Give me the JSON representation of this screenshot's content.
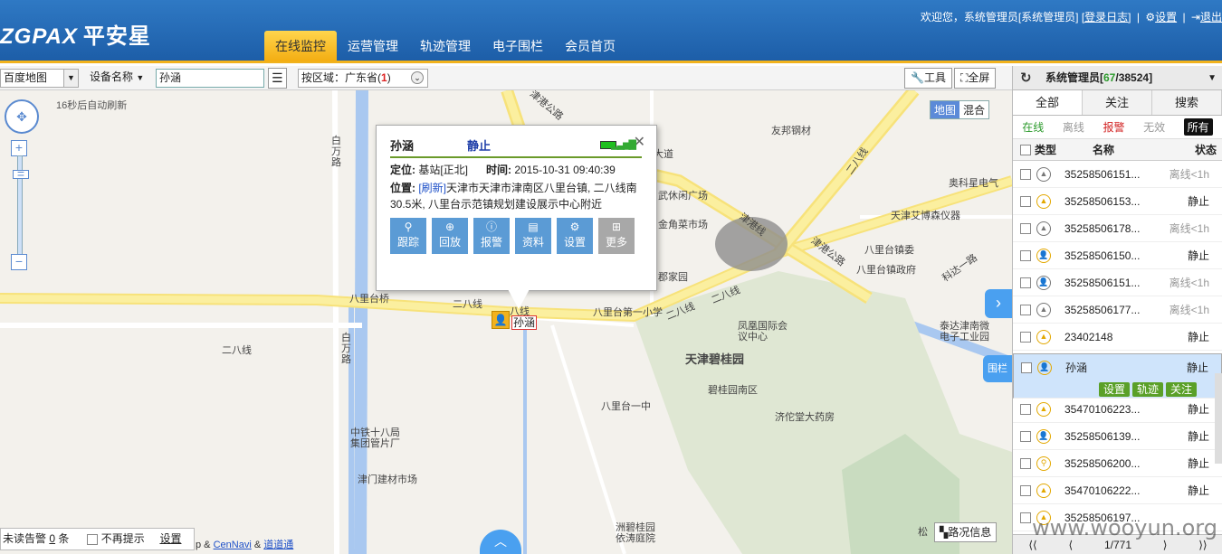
{
  "header": {
    "logo_en": "ZGPAX",
    "logo_cn": "平安星",
    "welcome": "欢迎您，系统管理员[系统管理员]",
    "login_log": "[登录日志]",
    "settings": "设置",
    "logout": "退出",
    "tabs": [
      {
        "label": "在线监控",
        "active": true
      },
      {
        "label": "运营管理"
      },
      {
        "label": "轨迹管理"
      },
      {
        "label": "电子围栏"
      },
      {
        "label": "会员首页"
      }
    ]
  },
  "toolbar": {
    "map_select": "百度地图",
    "search_field": "设备名称",
    "search_value": "孙涵",
    "region_label": "按区域：",
    "region_value": "广东省(",
    "region_count": "1",
    "region_close": ")",
    "tools_btn": "工具",
    "fullscreen_btn": "全屏"
  },
  "map": {
    "refresh": "16秒后自动刷新",
    "map_type_map": "地图",
    "map_type_mixed": "混合",
    "fence_btn": "围栏",
    "road_info": "路况信息",
    "copyright_prefix": "p &",
    "cennavi": "CenNavi",
    "amp": "&",
    "daodaotong": "道道通",
    "marker_label": "孙涵",
    "labels": {
      "bamian": "白万路",
      "jingang_top": "津港公路",
      "youbang": "友邦钢材",
      "dadao": "大道",
      "erbaxian_r": "二八线",
      "aokexing": "奥科星电气",
      "tianjinaitebo": "天津艾博森仪器",
      "jinjiao": "金角菜市场",
      "wuxiu": "武休闲广场",
      "jingang_mid": "津港线",
      "jingang_right": "津港公路",
      "baliwei": "八里台镇委",
      "balizf": "八里台镇政府",
      "kedaer": "科达一路",
      "jiajia": "郡家园",
      "baliqiao": "八里台桥",
      "erbaxian": "二八线",
      "baxian": "八线",
      "baliyi": "八里台第一小学",
      "erbaxian_m": "二八线",
      "erbaxian_m2": "二八线",
      "fenghuang": "凤凰国际会议中心",
      "taida": "泰达津南微电子工业园",
      "erbaxian_left": "二八线",
      "baiwan2": "白万路",
      "bigui": "天津碧桂园",
      "biguinan": "碧桂园南区",
      "balizhong": "八里台一中",
      "jituo": "济佗堂大药房",
      "zhongtie": "中铁十八局集团管片厂",
      "jinmen": "津门建材市场",
      "zhouqi": "洲碧桂园依涛庭院",
      "song": "松"
    },
    "alert": {
      "prefix": "未读告警",
      "count": "0",
      "suffix": "条",
      "no_remind": "不再提示",
      "settings": "设置"
    }
  },
  "popup": {
    "name": "孙涵",
    "status": "静止",
    "locate_label": "定位:",
    "locate_value": "基站[正北]",
    "time_label": "时间:",
    "time_value": "2015-10-31 09:40:39",
    "pos_label": "位置:",
    "refresh": "[刷新]",
    "address": "天津市天津市津南区八里台镇, 二八线南30.5米, 八里台示范镇规划建设展示中心附近",
    "actions": [
      "跟踪",
      "回放",
      "报警",
      "资料",
      "设置",
      "更多"
    ]
  },
  "sidebar": {
    "title": "系统管理员[",
    "online": "67",
    "slash": "/",
    "total": "38524",
    "close": "]",
    "tabs": [
      "全部",
      "关注",
      "搜索"
    ],
    "filters": [
      {
        "label": "在线",
        "color": "#2b9a2b"
      },
      {
        "label": "离线",
        "color": "#999999"
      },
      {
        "label": "报警",
        "color": "#d22222"
      },
      {
        "label": "无效",
        "color": "#999999"
      },
      {
        "label": "所有",
        "active": true
      }
    ],
    "cols": [
      "类型",
      "名称",
      "状态"
    ],
    "rows": [
      {
        "name": "35258506151...",
        "status": "离线<1h",
        "off": true,
        "type": "arrow-icon"
      },
      {
        "name": "35258506153...",
        "status": "静止",
        "type": "arrow-icon"
      },
      {
        "name": "35258506178...",
        "status": "离线<1h",
        "off": true,
        "type": "arrow-icon"
      },
      {
        "name": "35258506150...",
        "status": "静止",
        "type": "person-icon"
      },
      {
        "name": "35258506151...",
        "status": "离线<1h",
        "off": true,
        "type": "person-icon"
      },
      {
        "name": "35258506177...",
        "status": "离线<1h",
        "off": true,
        "type": "arrow-icon"
      },
      {
        "name": "23402148",
        "status": "静止",
        "type": "arrow-icon"
      },
      {
        "name": "孙涵",
        "status": "静止",
        "type": "person-icon",
        "selected": true
      },
      {
        "name": "35470106223...",
        "status": "静止",
        "type": "arrow-icon"
      },
      {
        "name": "35258506139...",
        "status": "静止",
        "type": "person-icon"
      },
      {
        "name": "35258506200...",
        "status": "静止",
        "type": "pin-icon"
      },
      {
        "name": "35470106222...",
        "status": "静止",
        "type": "arrow-icon"
      },
      {
        "name": "35258506197...",
        "status": "",
        "type": "arrow-icon"
      }
    ],
    "row_actions": [
      "设置",
      "轨迹",
      "关注"
    ],
    "pager": "1/771"
  },
  "watermark": "www.wooyun.org"
}
